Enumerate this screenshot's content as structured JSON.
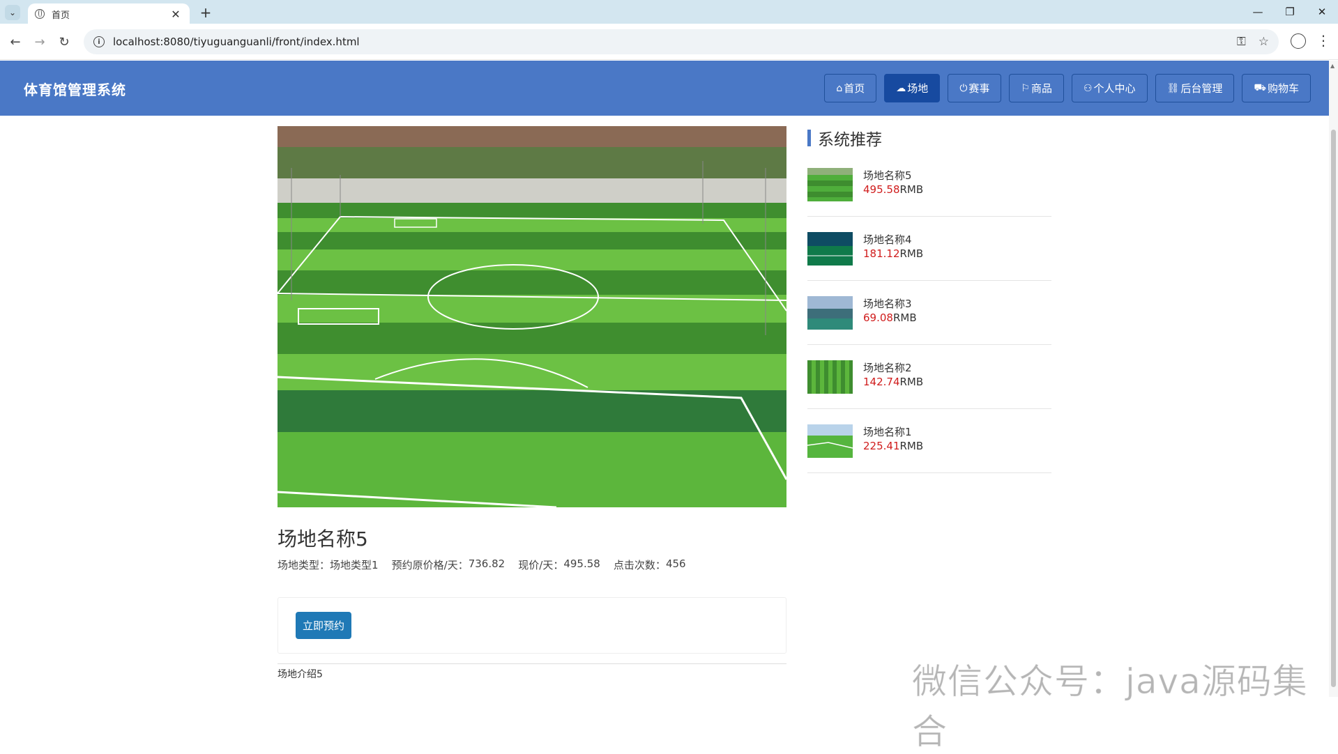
{
  "browser": {
    "tab_title": "首页",
    "url": "localhost:8080/tiyuguanguanli/front/index.html"
  },
  "header": {
    "site_title": "体育馆管理系统",
    "nav": [
      {
        "label": "首页",
        "icon": "home-icon"
      },
      {
        "label": "场地",
        "icon": "cloud-icon",
        "active": true
      },
      {
        "label": "赛事",
        "icon": "power-icon"
      },
      {
        "label": "商品",
        "icon": "flag-icon"
      },
      {
        "label": "个人中心",
        "icon": "user-icon"
      },
      {
        "label": "后台管理",
        "icon": "link-icon"
      },
      {
        "label": "购物车",
        "icon": "cart-icon"
      }
    ]
  },
  "detail": {
    "name": "场地名称5",
    "type_label": "场地类型：",
    "type_value": "场地类型1",
    "orig_price_label": "预约原价格/天：",
    "orig_price_value": "736.82",
    "price_label": "现价/天：",
    "price_value": "495.58",
    "clicks_label": "点击次数：",
    "clicks_value": "456",
    "book_button": "立即预约",
    "intro": "场地介绍5"
  },
  "sidebar": {
    "title": "系统推荐",
    "items": [
      {
        "name": "场地名称5",
        "price": "495.58",
        "unit": "RMB"
      },
      {
        "name": "场地名称4",
        "price": "181.12",
        "unit": "RMB"
      },
      {
        "name": "场地名称3",
        "price": "69.08",
        "unit": "RMB"
      },
      {
        "name": "场地名称2",
        "price": "142.74",
        "unit": "RMB"
      },
      {
        "name": "场地名称1",
        "price": "225.41",
        "unit": "RMB"
      }
    ]
  },
  "watermark": "微信公众号：java源码集合",
  "colors": {
    "header_bg": "#4a78c6",
    "nav_active": "#174aa0",
    "price_red": "#d01c1c",
    "button_blue": "#1f79b6"
  }
}
